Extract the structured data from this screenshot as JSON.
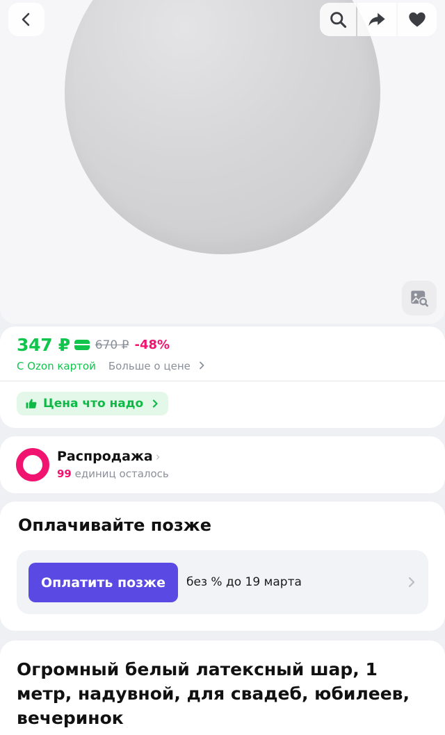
{
  "header": {
    "back_icon": "chevron-left-icon",
    "search_icon": "search-icon",
    "share_icon": "share-arrow-icon",
    "favorite_icon": "heart-icon",
    "image_search_icon": "image-search-icon"
  },
  "price": {
    "current": "347 ₽",
    "old": "670 ₽",
    "discount": "-48%",
    "ozon_card_label": "С Ozon картой",
    "more_label": "Больше о цене",
    "good_price_label": "Цена что надо"
  },
  "sale": {
    "title": "Распродажа",
    "count": "99",
    "remaining_label": "единиц осталось"
  },
  "pay_later": {
    "title": "Оплачивайте позже",
    "button_label": "Оплатить позже",
    "terms": "без % до 19 марта"
  },
  "product": {
    "title": "Огромный белый латексный шар, 1 метр, надувной, для свадеб, юбилеев, вечеринок"
  },
  "colors": {
    "green": "#10c44c",
    "pink": "#f0136f",
    "purple": "#5a4ae3"
  }
}
